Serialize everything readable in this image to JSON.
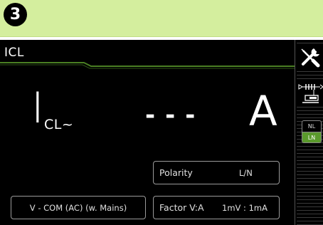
{
  "step": {
    "number": "3"
  },
  "screen": {
    "title": "ICL",
    "symbol_main": "I",
    "symbol_sub": "CL~",
    "reading": "---",
    "unit": "A"
  },
  "params": {
    "polarity": {
      "label": "Polarity",
      "value": "L/N"
    },
    "factor": {
      "label": "Factor V:A",
      "value": "1mV : 1mA"
    },
    "terminal": {
      "label": "V - COM (AC) (w. Mains)"
    }
  },
  "sidebar": {
    "tools_icon": "wrench-screwdriver-icon",
    "connection_icon": "probe-connection-icon",
    "toggle": {
      "options": [
        "NL",
        "LN"
      ],
      "selected": "LN"
    }
  },
  "colors": {
    "banner": "#d4ee9e",
    "screen_bg": "#000000",
    "accent_green": "#5a9a2c",
    "trace_green": "#4a7f23"
  }
}
